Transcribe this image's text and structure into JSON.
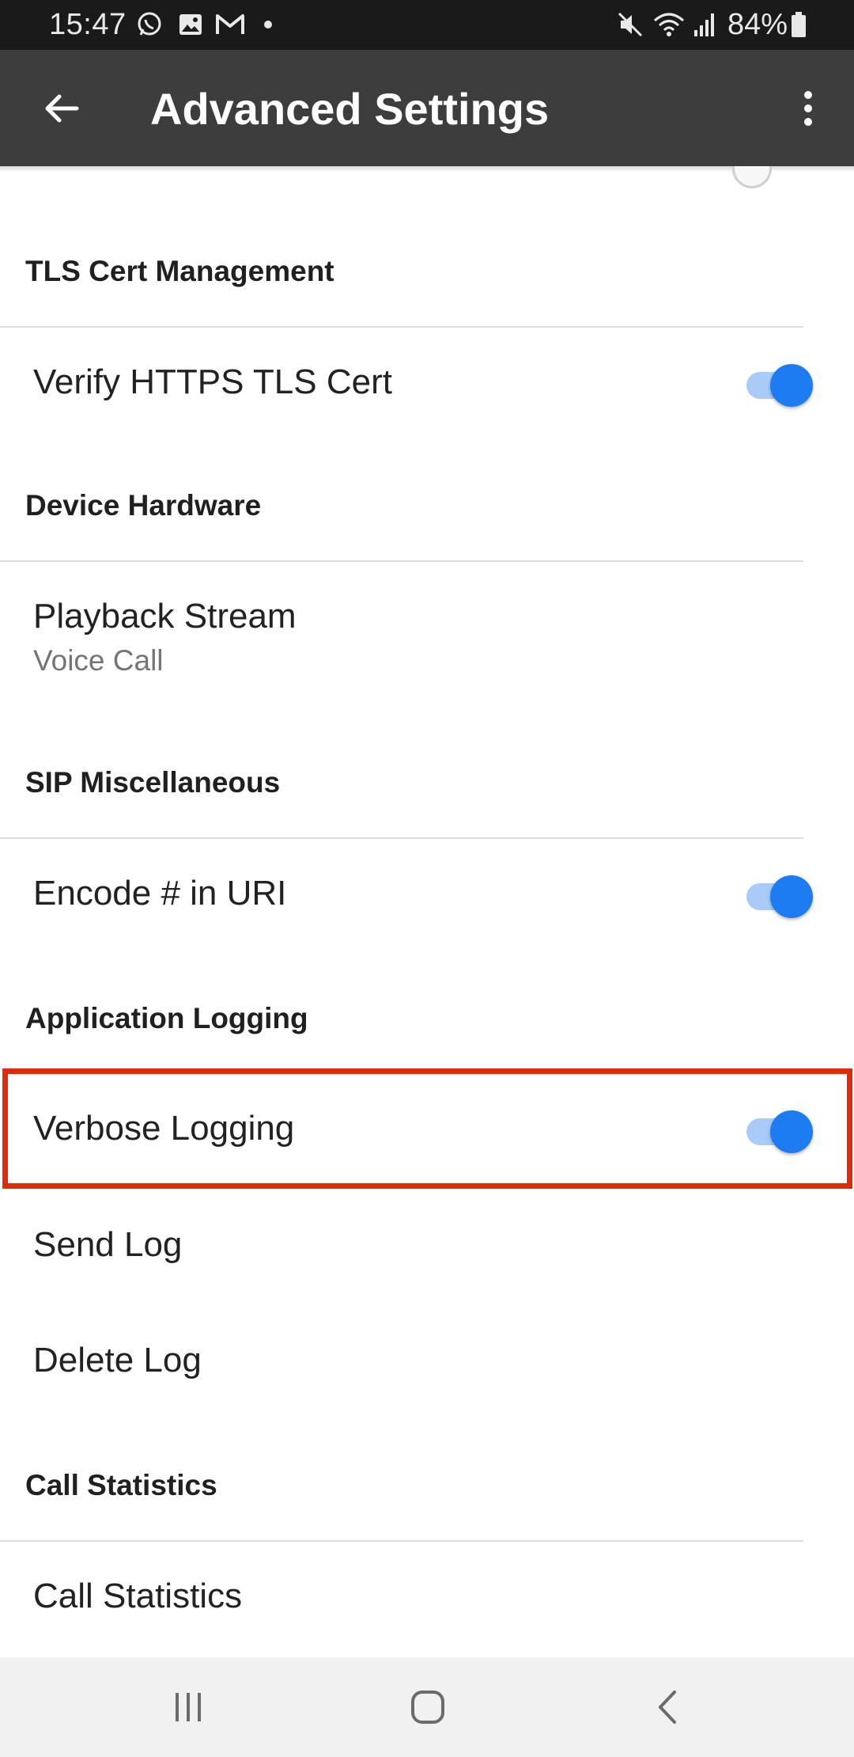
{
  "status_bar": {
    "time": "15:47",
    "battery": "84%",
    "icons": [
      "whatsapp-icon",
      "gallery-icon",
      "gmail-icon",
      "notification-dot-icon",
      "mute-icon",
      "wifi-icon",
      "signal-icon",
      "battery-icon"
    ]
  },
  "app_bar": {
    "title": "Advanced Settings",
    "back_icon": "arrow-back-icon",
    "menu_icon": "more-vert-icon"
  },
  "sections": {
    "tls": {
      "header": "TLS Cert Management",
      "verify_https": {
        "title": "Verify HTTPS TLS Cert",
        "enabled": true
      }
    },
    "device": {
      "header": "Device Hardware",
      "playback_stream": {
        "title": "Playback Stream",
        "summary": "Voice Call"
      }
    },
    "sip": {
      "header": "SIP Miscellaneous",
      "encode_hash": {
        "title": "Encode # in URI",
        "enabled": true
      }
    },
    "logging": {
      "header": "Application Logging",
      "verbose": {
        "title": "Verbose Logging",
        "enabled": true
      },
      "send_log": {
        "title": "Send Log"
      },
      "delete_log": {
        "title": "Delete Log"
      }
    },
    "stats": {
      "header": "Call Statistics",
      "call_statistics": {
        "title": "Call Statistics"
      }
    }
  },
  "colors": {
    "switch_on_thumb": "#1e7cf2",
    "switch_on_track": "#a8ccf7",
    "highlight": "#e02a0c",
    "app_bar": "#3d3d3d"
  },
  "nav_bar": {
    "icons": [
      "recent-apps-icon",
      "home-icon",
      "nav-back-icon"
    ]
  }
}
